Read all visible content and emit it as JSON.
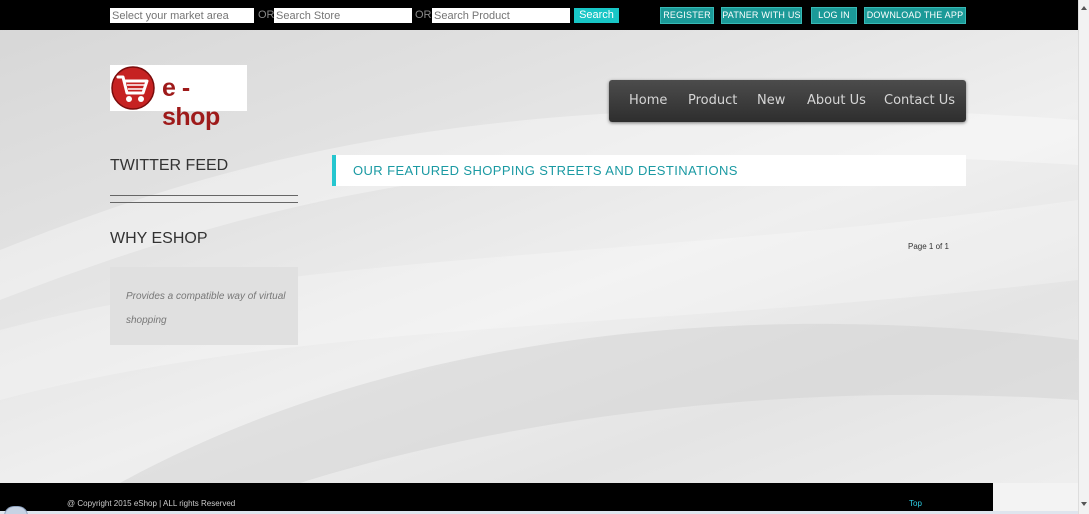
{
  "topbar": {
    "market_placeholder": "Select your market area",
    "or_1": "OR",
    "store_placeholder": "Search Store",
    "or_2": "OR",
    "product_placeholder": "Search Product",
    "search_label": "Search",
    "register_label": "REGISTER",
    "partner_label": "PATNER WITH US",
    "login_label": "LOG IN",
    "download_label": "DOWNLOAD THE APP"
  },
  "logo": {
    "text": "e -shop"
  },
  "nav": {
    "items": [
      "Home",
      "Product",
      "New",
      "About Us",
      "Contact Us"
    ]
  },
  "sidebar": {
    "twitter_heading": "TWITTER FEED",
    "why_heading": "WHY ESHOP",
    "why_text": "Provides a compatible way of virtual shopping"
  },
  "main": {
    "featured_title": "OUR FEATURED SHOPPING STREETS AND DESTINATIONS",
    "pager": "Page 1 of 1"
  },
  "footer": {
    "copyright": "@ Copyright 2015 eShop | ALL rights Reserved",
    "top_link": "Top"
  },
  "colors": {
    "accent": "#25c6cf",
    "brand": "#9e1a1a",
    "topbar": "#000000"
  }
}
